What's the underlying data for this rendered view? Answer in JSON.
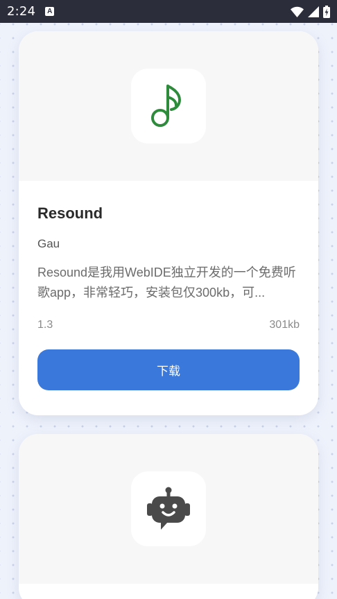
{
  "status_bar": {
    "time": "2:24",
    "notification_icon": "font-icon",
    "icons": [
      "wifi-icon",
      "signal-icon",
      "battery-charging-icon"
    ]
  },
  "apps": [
    {
      "name": "Resound",
      "author": "Gau",
      "description": "Resound是我用WebIDE独立开发的一个免费听歌app，非常轻巧，安装包仅300kb，可...",
      "version": "1.3",
      "size": "301kb",
      "download_label": "下载",
      "icon": "music-note-icon",
      "icon_color": "#2e8b3c"
    },
    {
      "icon": "robot-chat-icon",
      "icon_color": "#4a4a4a"
    }
  ],
  "colors": {
    "accent": "#3a78db",
    "background": "#eef2fb",
    "status_bar": "#2b2d3a"
  }
}
